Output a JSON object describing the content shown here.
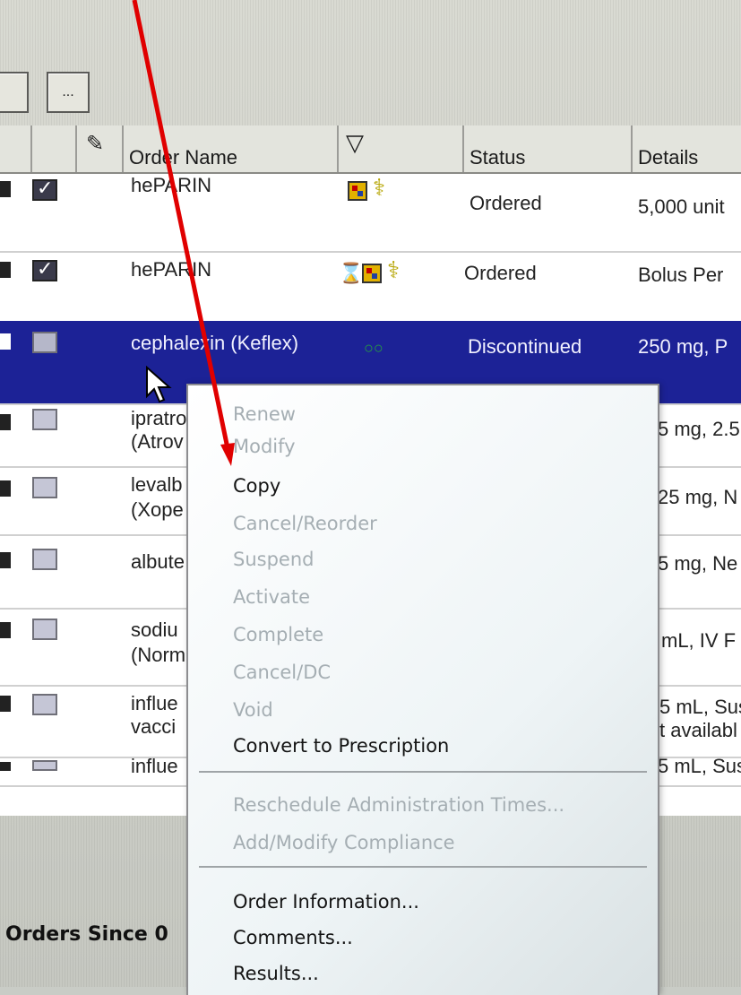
{
  "toolbar": {
    "ellipsis_label": "..."
  },
  "table": {
    "columns": [
      "Order Name",
      "Status",
      "Details"
    ],
    "rows": [
      {
        "name": "hePARIN",
        "status": "Ordered",
        "details": "5,000 unit",
        "checked": true,
        "icons": [
          "pill-icon",
          "caduceus-icon"
        ]
      },
      {
        "name": "hePARIN",
        "status": "Ordered",
        "details": "Bolus Per",
        "checked": true,
        "icons": [
          "hourglass-icon",
          "pill-icon",
          "caduceus-icon"
        ]
      },
      {
        "name": "cephalexin (Keflex)",
        "status": "Discontinued",
        "details": "250 mg, P",
        "checked": false,
        "selected": true,
        "icons": [
          "glasses-icon"
        ]
      },
      {
        "name": "ipratro",
        "name2": "(Atrov",
        "details": "5 mg, 2.5",
        "checked": false
      },
      {
        "name": "levalb",
        "name2": "(Xope",
        "details": "25 mg, N",
        "checked": false
      },
      {
        "name": "albute",
        "details": "5 mg, Ne",
        "checked": false
      },
      {
        "name": "sodiu",
        "name2": "(Norm",
        "details": "mL, IV F",
        "checked": false
      },
      {
        "name": "influe",
        "name2": "vacci",
        "details": "5 mL, Sus",
        "details2": "t availabl",
        "checked": false
      },
      {
        "name": "influe",
        "details": "5 mL, Sus",
        "checked": false
      }
    ]
  },
  "context_menu": {
    "items": [
      {
        "label": "Renew",
        "enabled": false
      },
      {
        "label": "Modify",
        "enabled": false
      },
      {
        "label": "Copy",
        "enabled": true
      },
      {
        "label": "Cancel/Reorder",
        "enabled": false
      },
      {
        "label": "Suspend",
        "enabled": false
      },
      {
        "label": "Activate",
        "enabled": false
      },
      {
        "label": "Complete",
        "enabled": false
      },
      {
        "label": "Cancel/DC",
        "enabled": false
      },
      {
        "label": "Void",
        "enabled": false
      },
      {
        "label": "Convert to Prescription",
        "enabled": true
      },
      {
        "label": "Reschedule Administration Times...",
        "enabled": false
      },
      {
        "label": "Add/Modify Compliance",
        "enabled": false
      },
      {
        "label": "Order Information...",
        "enabled": true
      },
      {
        "label": "Comments...",
        "enabled": true
      },
      {
        "label": "Results...",
        "enabled": true
      }
    ]
  },
  "footer": {
    "label": "Orders Since 0"
  },
  "colors": {
    "selection": "#1c2296",
    "annotation_arrow": "#e00000"
  }
}
